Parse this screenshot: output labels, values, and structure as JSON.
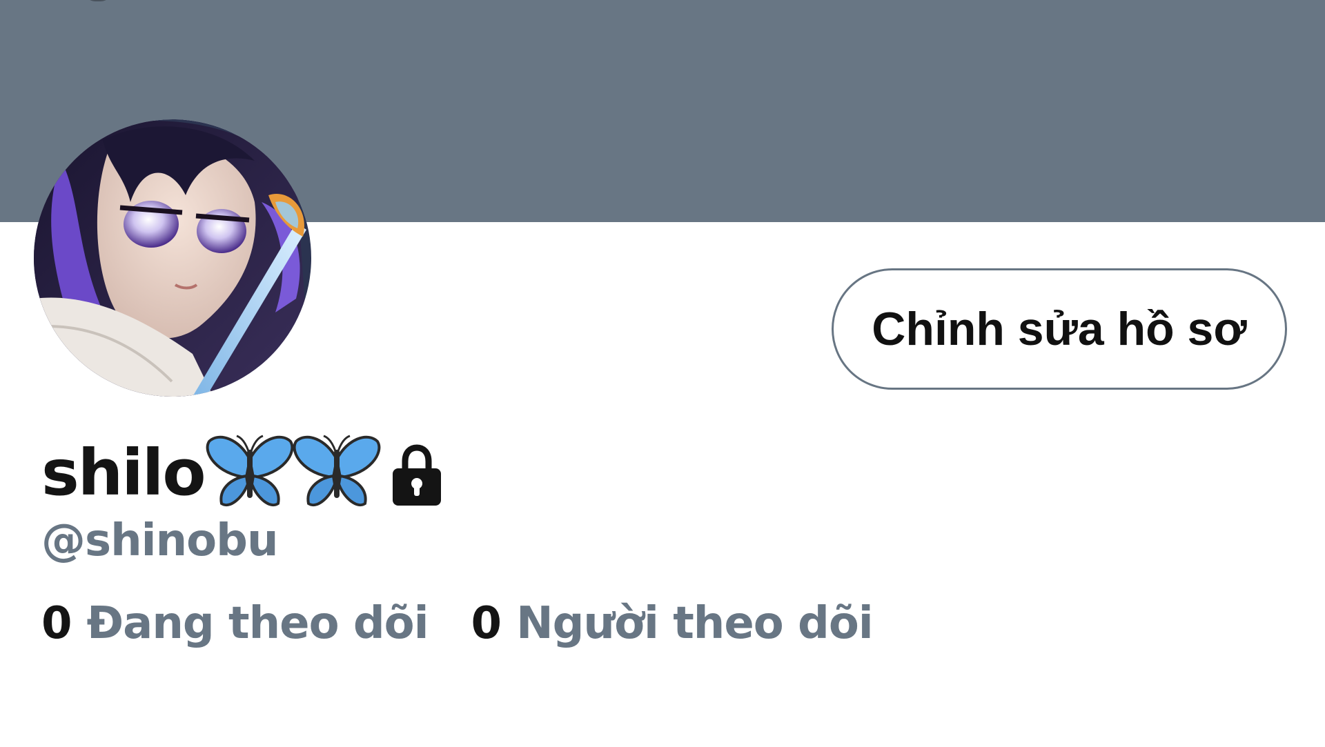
{
  "profile": {
    "display_name": "shilo",
    "name_emojis": [
      "butterfly-icon",
      "butterfly-icon"
    ],
    "protected_icon": "lock-icon",
    "handle": "@shinobu",
    "avatar_icon": "avatar",
    "edit_button_label": "Chỉnh sửa hồ sơ"
  },
  "stats": {
    "following": {
      "count": "0",
      "label": "Đang theo dõi"
    },
    "followers": {
      "count": "0",
      "label": "Người theo dõi"
    }
  },
  "colors": {
    "banner": "#687684",
    "secondary_text": "#687684",
    "primary_text": "#141414",
    "button_border": "#677583",
    "butterfly": "#5aa9ec"
  }
}
